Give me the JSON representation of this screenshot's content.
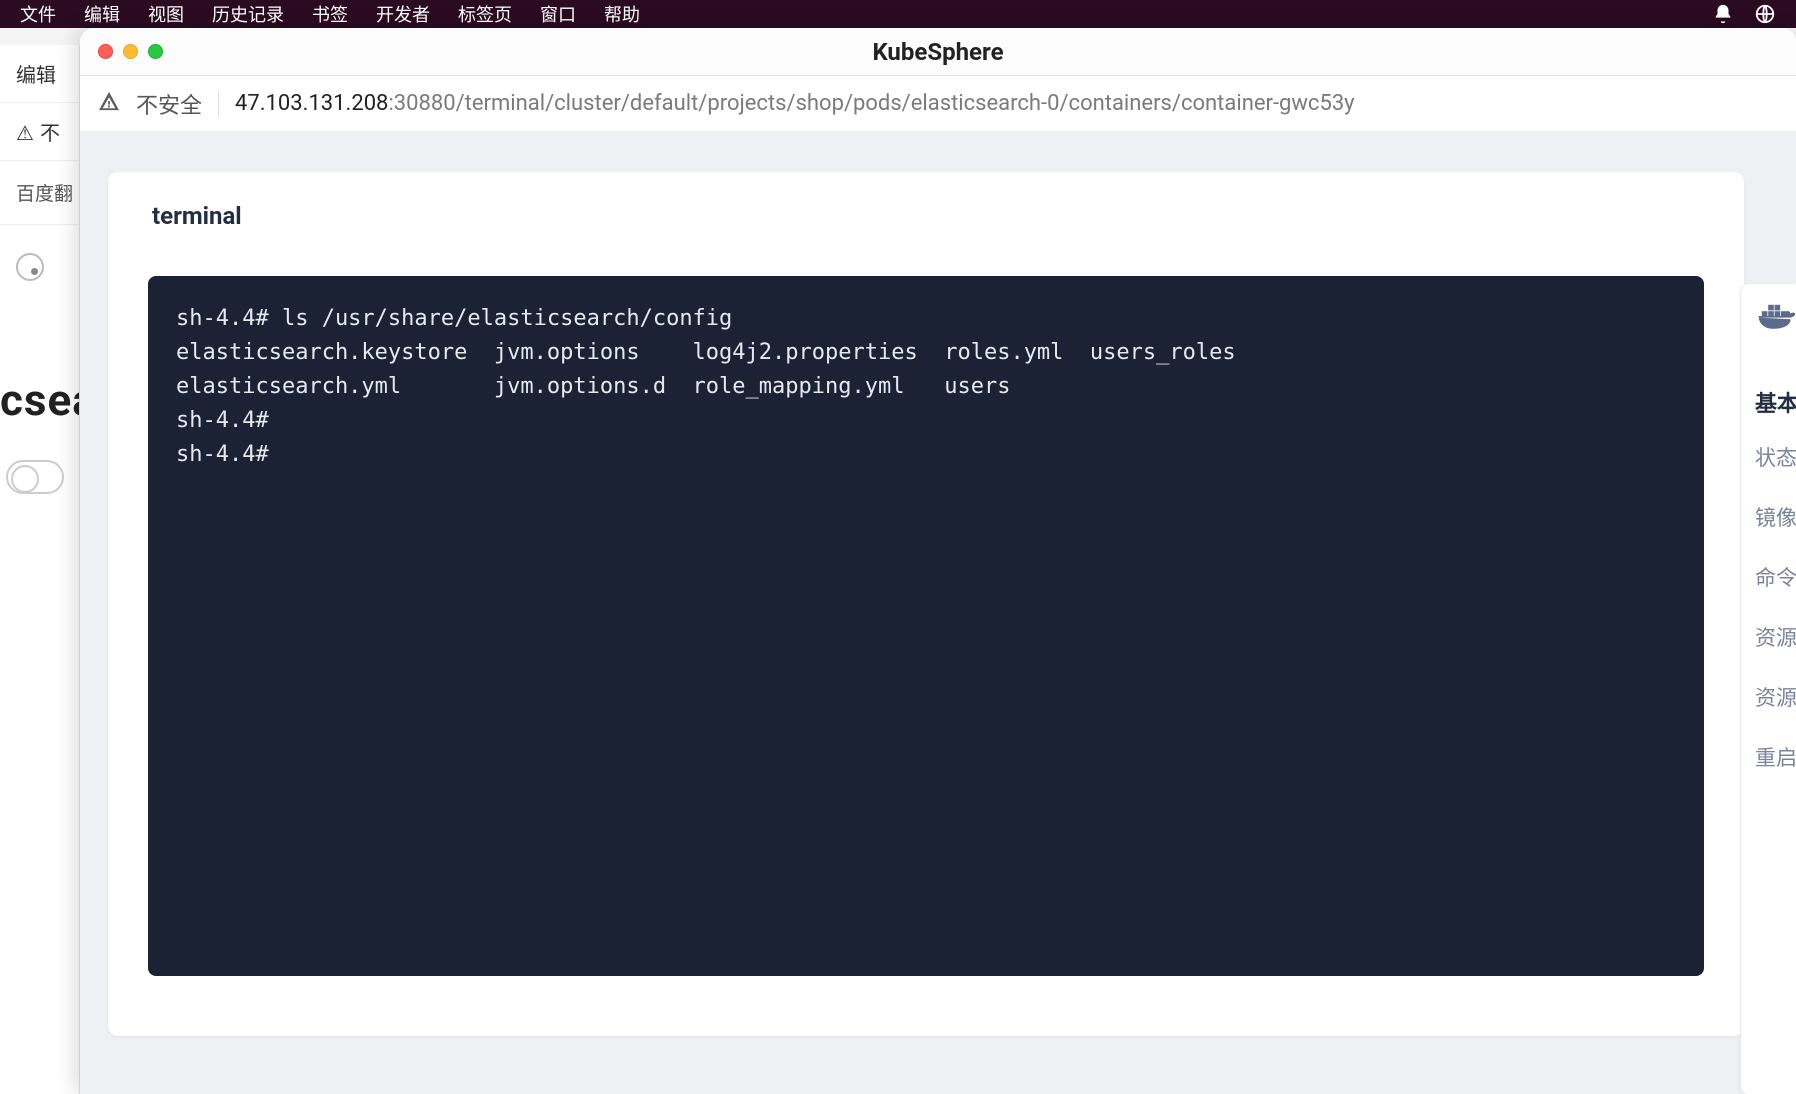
{
  "bg_menu": {
    "items": [
      "文件",
      "编辑",
      "视图",
      "历史记录",
      "书签",
      "开发者",
      "标签页",
      "窗口",
      "帮助"
    ]
  },
  "bg_window": {
    "toolbar_label": "编辑",
    "security_label": "不",
    "tab_label": "百度翻",
    "big_label": "csea"
  },
  "window": {
    "title": "KubeSphere",
    "security_label": "不安全",
    "url_host": "47.103.131.208",
    "url_path": ":30880/terminal/cluster/default/projects/shop/pods/elasticsearch-0/containers/container-gwc53y"
  },
  "page": {
    "terminal_title": "terminal"
  },
  "terminal": {
    "lines": [
      "sh-4.4# ls /usr/share/elasticsearch/config",
      "elasticsearch.keystore  jvm.options    log4j2.properties  roles.yml  users_roles",
      "elasticsearch.yml       jvm.options.d  role_mapping.yml   users",
      "sh-4.4#",
      "sh-4.4# "
    ]
  },
  "right_panel": {
    "heading": "基本信",
    "items": [
      "状态",
      "镜像",
      "命令",
      "资源",
      "资源",
      "重启"
    ]
  }
}
